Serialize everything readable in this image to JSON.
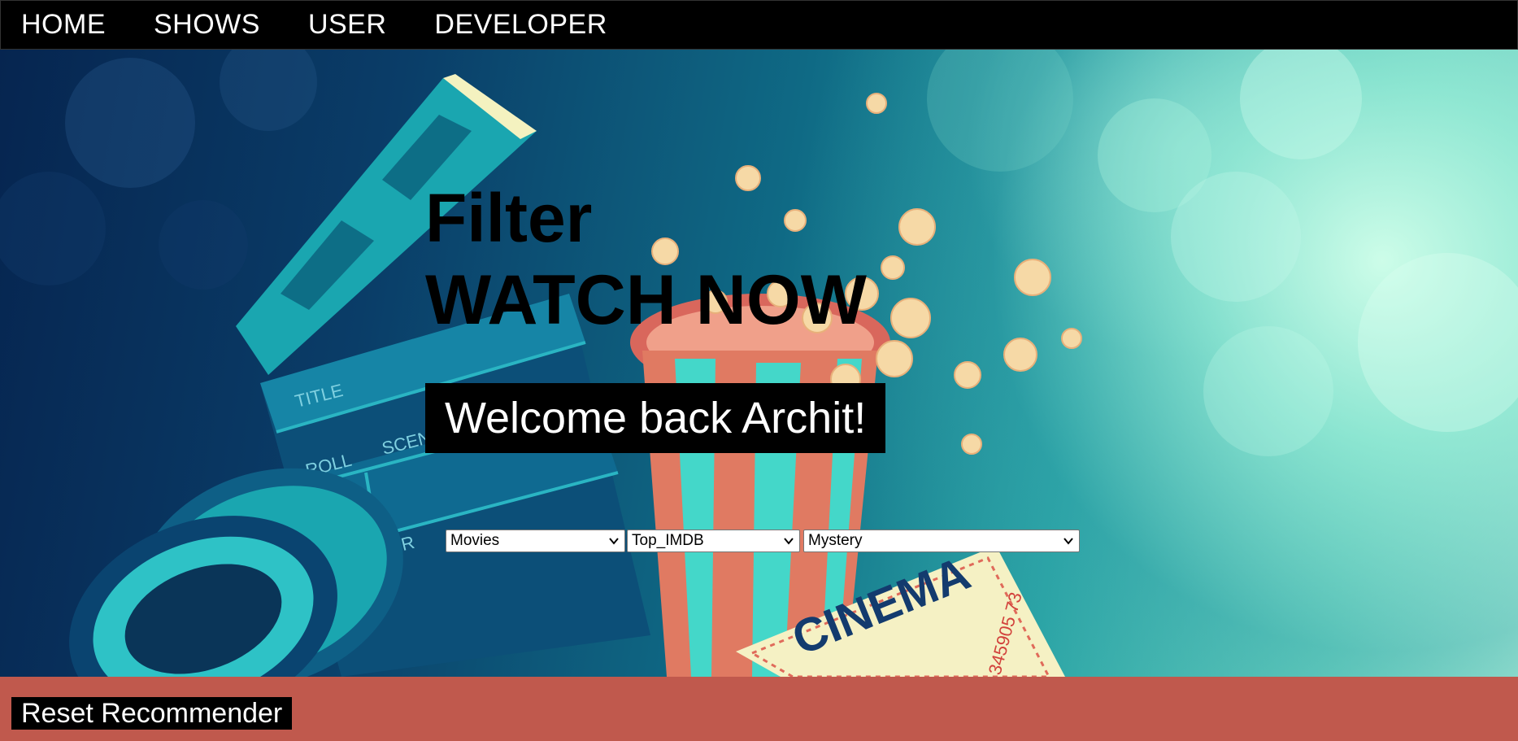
{
  "nav": {
    "items": [
      "HOME",
      "SHOWS",
      "USER",
      "DEVELOPER"
    ]
  },
  "hero": {
    "title": "Filter",
    "subtitle": "WATCH NOW",
    "welcome": "Welcome back Archit!"
  },
  "filters": {
    "type": "Movies",
    "list": "Top_IMDB",
    "genre": "Mystery"
  },
  "footer": {
    "reset_label": "Reset Recommender"
  },
  "colors": {
    "nav_bg": "#000000",
    "footer_bg": "#c0594d",
    "accent_teal": "#2aa5a5"
  }
}
